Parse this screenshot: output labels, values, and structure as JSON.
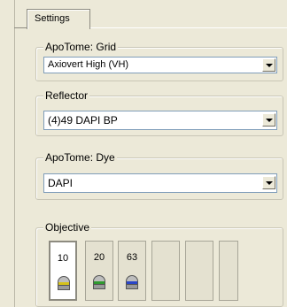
{
  "tab": {
    "label": "Settings"
  },
  "apotome_grid": {
    "label": "ApoTome: Grid",
    "value": "Axiovert High (VH)"
  },
  "reflector": {
    "label": "Reflector",
    "value": "(4)49 DAPI BP"
  },
  "apotome_dye": {
    "label": "ApoTome: Dye",
    "value": "DAPI"
  },
  "objective": {
    "label": "Objective",
    "items": [
      {
        "magnification": "10",
        "band_color": "#d6c21a",
        "selected": true
      },
      {
        "magnification": "20",
        "band_color": "#2f9a2f",
        "selected": false
      },
      {
        "magnification": "63",
        "band_color": "#2a46c8",
        "selected": false
      },
      {
        "magnification": "",
        "band_color": "",
        "selected": false
      },
      {
        "magnification": "",
        "band_color": "",
        "selected": false
      },
      {
        "magnification": "",
        "band_color": "",
        "selected": false
      }
    ]
  }
}
